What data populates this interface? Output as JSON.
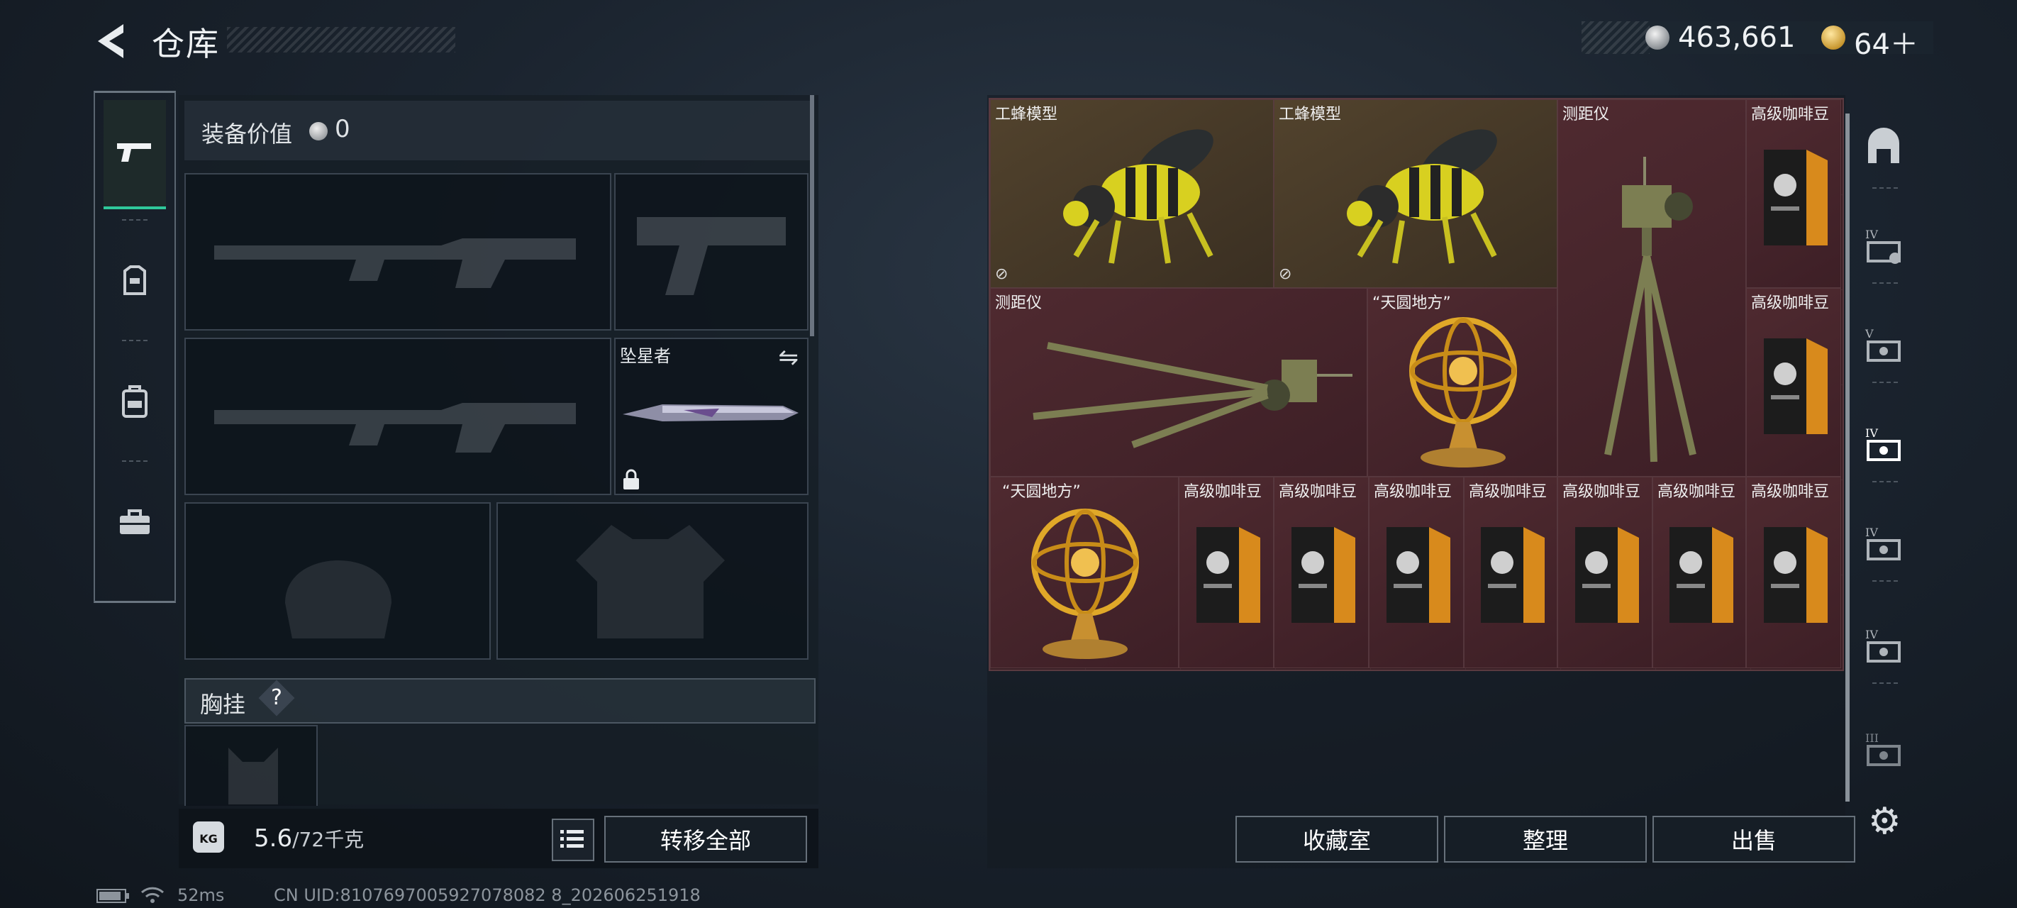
{
  "header": {
    "title": "仓库",
    "currency_value": "463,661",
    "ticket_value": "64＋"
  },
  "left_tabs": [
    {
      "name": "weapons",
      "icon": "pistol-icon",
      "active": true
    },
    {
      "name": "armor",
      "icon": "armor-icon",
      "active": false
    },
    {
      "name": "backpack",
      "icon": "backpack-icon",
      "active": false
    },
    {
      "name": "toolbox",
      "icon": "toolbox-icon",
      "active": false
    }
  ],
  "equipment": {
    "value_label": "装备价值",
    "value": "0",
    "melee_name": "坠星者",
    "chest_label": "胸挂",
    "chest_help": "?"
  },
  "weight": {
    "current": "5.6",
    "max": "/72千克",
    "icon_text": "KG"
  },
  "buttons": {
    "transfer_all": "转移全部",
    "collection": "收藏室",
    "organize": "整理",
    "sell": "出售"
  },
  "items": [
    {
      "label": "工蜂模型",
      "icon": "bee-model-icon",
      "tradeable": false
    },
    {
      "label": "工蜂模型",
      "icon": "bee-model-icon",
      "tradeable": false
    },
    {
      "label": "测距仪",
      "icon": "rangefinder-icon"
    },
    {
      "label": "高级咖啡豆",
      "icon": "coffee-bag-icon"
    },
    {
      "label": "测距仪",
      "icon": "rangefinder-icon"
    },
    {
      "label": "“天圆地方”",
      "icon": "armillary-sphere-icon"
    },
    {
      "label": "高级咖啡豆",
      "icon": "coffee-bag-icon"
    },
    {
      "label": "“天圆地方”",
      "icon": "armillary-sphere-icon"
    },
    {
      "label": "高级咖啡豆",
      "icon": "coffee-bag-icon"
    },
    {
      "label": "高级咖啡豆",
      "icon": "coffee-bag-icon"
    },
    {
      "label": "高级咖啡豆",
      "icon": "coffee-bag-icon"
    },
    {
      "label": "高级咖啡豆",
      "icon": "coffee-bag-icon"
    },
    {
      "label": "高级咖啡豆",
      "icon": "coffee-bag-icon"
    },
    {
      "label": "高级咖啡豆",
      "icon": "coffee-bag-icon"
    },
    {
      "label": "高级咖啡豆",
      "icon": "coffee-bag-icon"
    }
  ],
  "right_sidebar": [
    {
      "icon": "storage-arch-icon"
    },
    {
      "icon": "tier-iv-container-icon",
      "tier": "IV"
    },
    {
      "icon": "tier-v-container-icon",
      "tier": "V"
    },
    {
      "icon": "tier-iv-container-selected-icon",
      "tier": "IV"
    },
    {
      "icon": "tier-iv-container-icon",
      "tier": "IV"
    },
    {
      "icon": "tier-iv-container-icon",
      "tier": "IV"
    },
    {
      "icon": "tier-iii-container-icon",
      "tier": "III"
    }
  ],
  "status": {
    "ping": "52ms",
    "uid": "CN UID:8107697005927078082 8_202606251918"
  }
}
